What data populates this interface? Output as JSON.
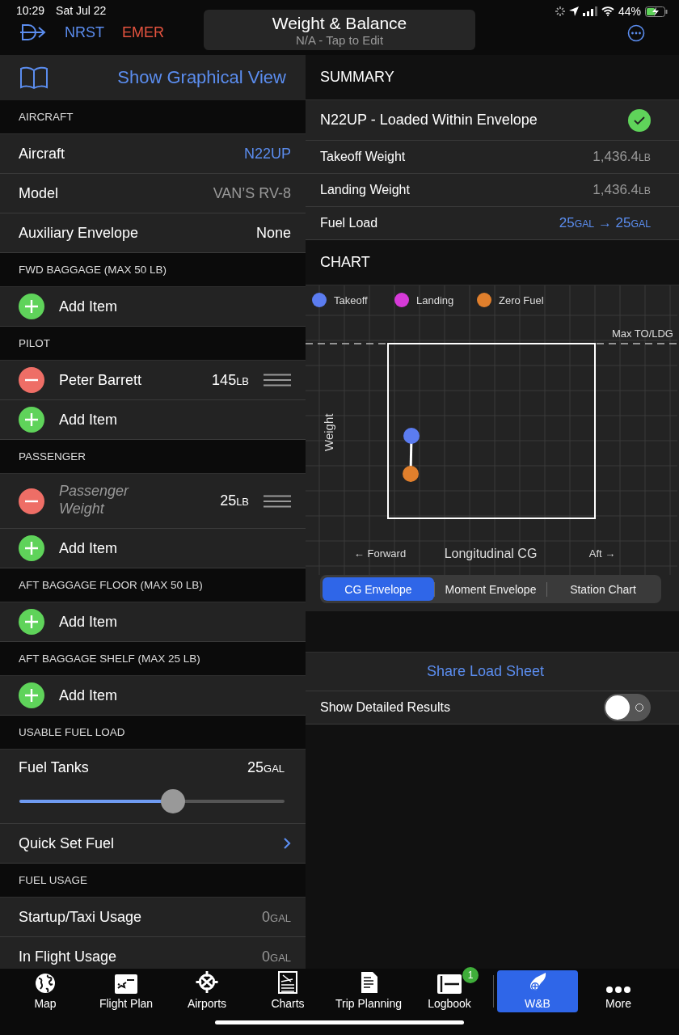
{
  "status_bar": {
    "time": "10:29",
    "date": "Sat Jul 22",
    "battery": "44%"
  },
  "nav": {
    "nrst": "NRST",
    "emer": "EMER",
    "title": "Weight & Balance",
    "subtitle": "N/A - Tap to Edit"
  },
  "left": {
    "graphical_link": "Show Graphical View",
    "sections": [
      {
        "title": "AIRCRAFT",
        "rows": [
          {
            "kind": "link_value",
            "label": "Aircraft",
            "value": "N22UP"
          },
          {
            "kind": "muted_value",
            "label": "Model",
            "value": "VAN’S RV-8"
          },
          {
            "kind": "plain_value",
            "label": "Auxiliary Envelope",
            "value": "None"
          }
        ]
      },
      {
        "title": "FWD BAGGAGE (MAX 50 LB)",
        "rows": [
          {
            "kind": "add",
            "label": "Add Item"
          }
        ]
      },
      {
        "title": "PILOT",
        "rows": [
          {
            "kind": "item",
            "label": "Peter Barrett",
            "value": "145",
            "unit": "LB"
          },
          {
            "kind": "add",
            "label": "Add Item"
          }
        ]
      },
      {
        "title": "PASSENGER",
        "rows": [
          {
            "kind": "item",
            "placeholder": "Passenger Weight",
            "value": "25",
            "unit": "LB"
          },
          {
            "kind": "add",
            "label": "Add Item"
          }
        ]
      },
      {
        "title": "AFT BAGGAGE FLOOR (MAX 50 LB)",
        "rows": [
          {
            "kind": "add",
            "label": "Add Item"
          }
        ]
      },
      {
        "title": "AFT BAGGAGE SHELF (MAX 25 LB)",
        "rows": [
          {
            "kind": "add",
            "label": "Add Item"
          }
        ]
      },
      {
        "title": "USABLE FUEL LOAD",
        "rows": [
          {
            "kind": "slider",
            "label": "Fuel Tanks",
            "value": "25",
            "unit": "GAL",
            "level": 0.58
          },
          {
            "kind": "link",
            "label": "Quick Set Fuel"
          }
        ]
      },
      {
        "title": "FUEL USAGE",
        "rows": [
          {
            "kind": "usage",
            "label": "Startup/Taxi Usage",
            "value": "0",
            "unit": "GAL"
          },
          {
            "kind": "usage",
            "label": "In Flight Usage",
            "value": "0",
            "unit": "GAL"
          }
        ]
      }
    ]
  },
  "summary": {
    "title": "SUMMARY",
    "status": "N22UP - Loaded Within Envelope",
    "ok": true,
    "rows": [
      {
        "label": "Takeoff Weight",
        "value": "1,436.4",
        "unit": "LB"
      },
      {
        "label": "Landing Weight",
        "value": "1,436.4",
        "unit": "LB"
      }
    ],
    "fuel_load": {
      "label": "Fuel Load",
      "from_value": "25",
      "from_unit": "GAL",
      "arrow": "→",
      "to_value": "25",
      "to_unit": "GAL"
    }
  },
  "chart": {
    "title": "CHART",
    "legend": [
      {
        "label": "Takeoff",
        "color": "#5b7cf0"
      },
      {
        "label": "Landing",
        "color": "#d63ad8"
      },
      {
        "label": "Zero Fuel",
        "color": "#e07f2c"
      }
    ],
    "limit_label": "Max TO/LDG",
    "y_label": "Weight",
    "x_label": "Longitudinal CG",
    "forward": "← Forward",
    "aft": "Aft →",
    "segments": [
      {
        "label": "CG Envelope",
        "selected": true
      },
      {
        "label": "Moment Envelope",
        "selected": false
      },
      {
        "label": "Station Chart",
        "selected": false
      }
    ]
  },
  "share": "Share Load Sheet",
  "detailed": {
    "label": "Show Detailed Results",
    "on": false
  },
  "tabs": [
    {
      "kind": "globe",
      "label": "Map",
      "selected": false
    },
    {
      "kind": "plan",
      "label": "Flight Plan",
      "selected": false
    },
    {
      "kind": "airport",
      "label": "Airports",
      "selected": false
    },
    {
      "kind": "charts",
      "label": "Charts",
      "selected": false
    },
    {
      "kind": "trip",
      "label": "Trip Planning",
      "selected": false
    },
    {
      "kind": "logbook",
      "label": "Logbook",
      "selected": false,
      "badge": "1"
    },
    {
      "kind": "wb",
      "label": "W&B",
      "selected": true
    },
    {
      "kind": "more",
      "label": "More",
      "selected": false
    }
  ]
}
